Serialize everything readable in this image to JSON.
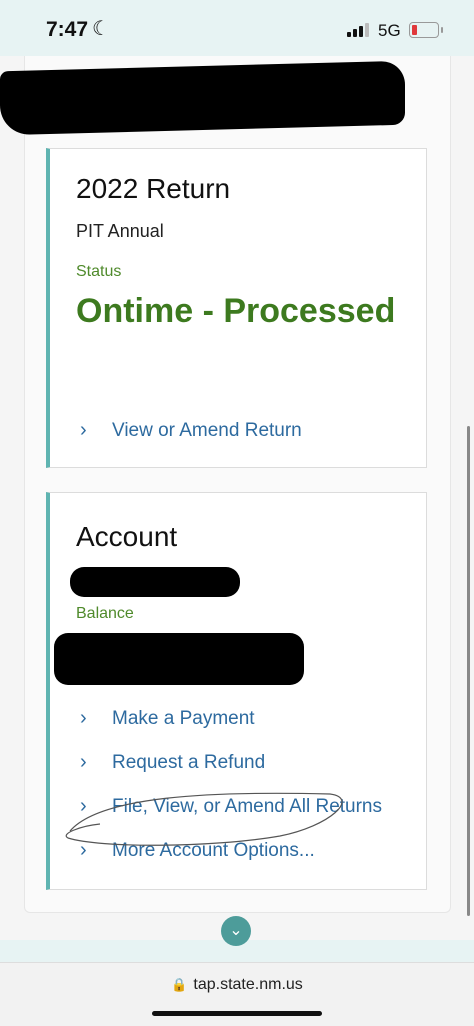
{
  "status_bar": {
    "time": "7:47",
    "network": "5G"
  },
  "return_card": {
    "title": "2022 Return",
    "subtitle": "PIT Annual",
    "status_label": "Status",
    "status_value": "Ontime - Processed",
    "link": "View or Amend Return"
  },
  "account_card": {
    "title": "Account",
    "balance_label": "Balance",
    "links": [
      "Make a Payment",
      "Request a Refund",
      "File, View, or Amend All Returns",
      "More Account Options..."
    ]
  },
  "browser": {
    "url": "tap.state.nm.us"
  },
  "colors": {
    "accent_green": "#3d7a1f",
    "link_blue": "#2d6a9f",
    "card_border_teal": "#5fb4b1",
    "button_teal": "#4d9c9a"
  },
  "icons": {
    "chevron": "chevron-right-icon",
    "lock": "lock-icon",
    "moon": "moon-icon",
    "down": "chevron-down-icon"
  }
}
